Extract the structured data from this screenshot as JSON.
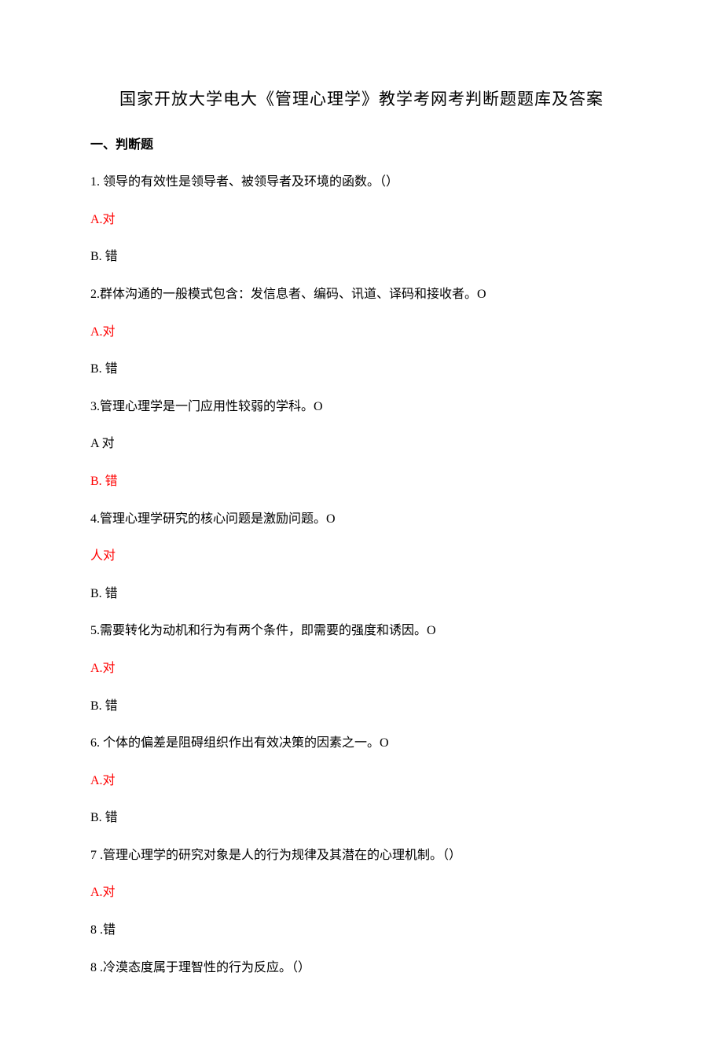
{
  "title": "国家开放大学电大《管理心理学》教学考网考判断题题库及答案",
  "section_heading": "一、判断题",
  "items": [
    {
      "text": "1. 领导的有效性是领导者、被领导者及环境的函数。（）",
      "highlight": false
    },
    {
      "text": "A.对",
      "highlight": true
    },
    {
      "text": "B. 错",
      "highlight": false
    },
    {
      "text": "2.群体沟通的一般模式包含：发信息者、编码、讯道、译码和接收者。O",
      "highlight": false
    },
    {
      "text": "A.对",
      "highlight": true
    },
    {
      "text": "B. 错",
      "highlight": false
    },
    {
      "text": "3.管理心理学是一门应用性较弱的学科。O",
      "highlight": false
    },
    {
      "text": "A 对",
      "highlight": false
    },
    {
      "text": "B. 错",
      "highlight": true
    },
    {
      "text": "4.管理心理学研究的核心问题是激励问题。O",
      "highlight": false
    },
    {
      "text": "人对",
      "highlight": true
    },
    {
      "text": "B. 错",
      "highlight": false
    },
    {
      "text": "5.需要转化为动机和行为有两个条件，即需要的强度和诱因。O",
      "highlight": false
    },
    {
      "text": "A.对",
      "highlight": true
    },
    {
      "text": "B. 错",
      "highlight": false
    },
    {
      "text": "6. 个体的偏差是阻碍组织作出有效决策的因素之一。O",
      "highlight": false
    },
    {
      "text": "A.对",
      "highlight": true
    },
    {
      "text": "B. 错",
      "highlight": false
    },
    {
      "text": "7  .管理心理学的研究对象是人的行为规律及其潜在的心理机制。（）",
      "highlight": false
    },
    {
      "text": "A.对",
      "highlight": true
    },
    {
      "text": "8  .错",
      "highlight": false
    },
    {
      "text": "8  .冷漠态度属于理智性的行为反应。（）",
      "highlight": false
    }
  ]
}
